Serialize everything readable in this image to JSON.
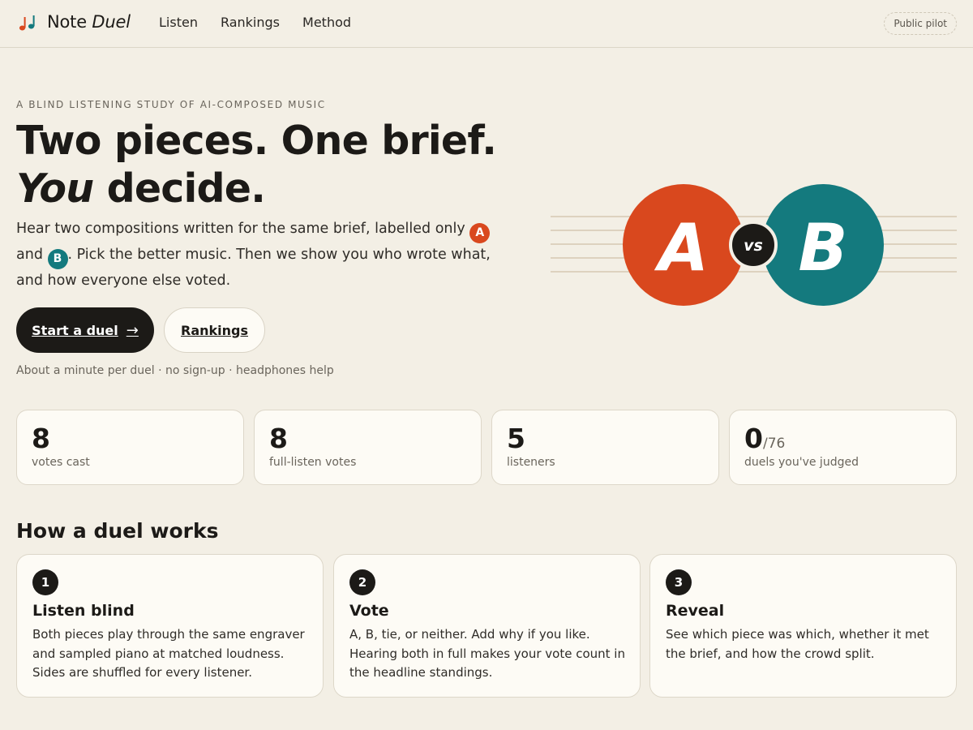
{
  "header": {
    "brand_part1": "Note",
    "brand_part2": "Duel",
    "nav": [
      "Listen",
      "Rankings",
      "Method"
    ],
    "badge": "Public pilot"
  },
  "hero": {
    "eyebrow": "A BLIND LISTENING STUDY OF AI-COMPOSED MUSIC",
    "headline_line1": "Two pieces. One brief.",
    "headline_em": "You",
    "headline_rest": " decide.",
    "lede_part1": "Hear two compositions written for the same brief, labelled only ",
    "chip_a": "A",
    "lede_part2": " and ",
    "chip_b": "B",
    "lede_part3": ". Pick the better music. Then we show you who wrote what, and how everyone else voted.",
    "primary_button": "Start a duel",
    "primary_arrow": "→",
    "secondary_button": "Rankings",
    "footnote": "About a minute per duel · no sign-up · headphones help",
    "art": {
      "left_label": "A",
      "right_label": "B",
      "center_label": "vs"
    }
  },
  "stats": [
    {
      "value": "8",
      "suffix": "",
      "label": "votes cast"
    },
    {
      "value": "8",
      "suffix": "",
      "label": "full-listen votes"
    },
    {
      "value": "5",
      "suffix": "",
      "label": "listeners"
    },
    {
      "value": "0",
      "suffix": "/76",
      "label": "duels you've judged"
    }
  ],
  "how": {
    "title": "How a duel works",
    "steps": [
      {
        "number": "1",
        "title": "Listen blind",
        "desc": "Both pieces play through the same engraver and sampled piano at matched loudness. Sides are shuffled for every listener."
      },
      {
        "number": "2",
        "title": "Vote",
        "desc": "A, B, tie, or neither. Add why if you like. Hearing both in full makes your vote count in the headline standings."
      },
      {
        "number": "3",
        "title": "Reveal",
        "desc": "See which piece was which, whether it met the brief, and how the crowd split."
      }
    ]
  },
  "colors": {
    "background": "#f3efe5",
    "card": "#fdfbf5",
    "ink": "#1c1a17",
    "accent_a": "#d9481e",
    "accent_b": "#147a7e",
    "staff_line": "#ddd2bf"
  },
  "icons": {
    "logo": "music-notes-icon",
    "arrow": "arrow-right-icon"
  }
}
